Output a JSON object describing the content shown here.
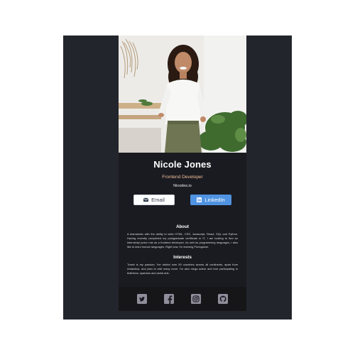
{
  "profile": {
    "name": "Nicole Jones",
    "role": "Frontend Developer",
    "website": "Nicodes.io"
  },
  "buttons": {
    "email": {
      "label": "Email",
      "icon": "envelope-icon"
    },
    "linkedin": {
      "label": "LinkedIn",
      "icon": "linkedin-icon"
    }
  },
  "about": {
    "title": "About",
    "text": "A learnaholic with the ability to write HTML, CSS, Javascript, React, SQL and Python. Having recently completed my postgraduate certificate in IT, I am looking to find an internship/ junior role as a frontend developer. As well as programming languages, I also like to learn human languages. Right now, I'm learning Portuguese."
  },
  "interests": {
    "title": "Interests",
    "text": "Travel is my passion; I've visited over 50 countries across all continents, apart from Antarctica, and plan to visit many more. I'm also mega active and love participating in triathlons, spartans and aerial arts."
  },
  "footer": {
    "icons": [
      "twitter-icon",
      "facebook-icon",
      "instagram-icon",
      "github-icon"
    ]
  },
  "colors": {
    "page_background": "#23252c",
    "card_background": "#1a1b21",
    "footer_background": "#161619",
    "role_accent": "#f3bf99",
    "linkedin_blue": "#5093e2"
  }
}
